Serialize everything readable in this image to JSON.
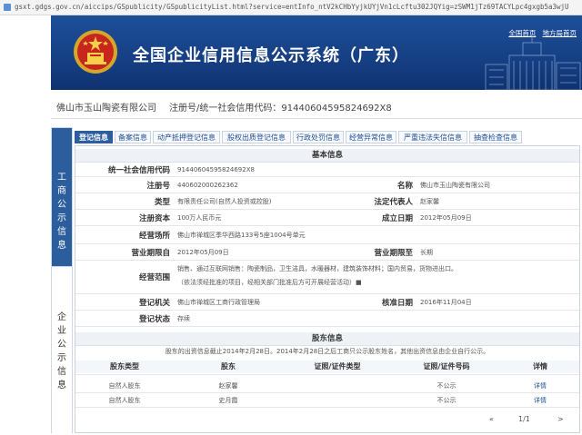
{
  "browser": {
    "url": "gsxt.gdgs.gov.cn/aiccips/GSpublicity/GSpublicityList.html?service=entInfo_ntV2kCHbYyjkUYjVn1cLcftu302JQYig=zSWM1jTz69TACYLpc4gxgb5a3wjU"
  },
  "header": {
    "title": "全国企业信用信息公示系统（广东）",
    "link_home": "全国首页",
    "link_local": "地方局首页"
  },
  "company": {
    "name": "佛山市玉山陶瓷有限公司",
    "reg_label": "注册号/统一社会信用代码：",
    "reg_code": "91440604595824692X8"
  },
  "sidebar": {
    "section_a": [
      "工",
      "商",
      "公",
      "示",
      "信",
      "息"
    ],
    "section_b": [
      "企",
      "业",
      "公",
      "示",
      "信",
      "息"
    ]
  },
  "tabs": [
    {
      "label": "登记信息",
      "active": true
    },
    {
      "label": "备案信息",
      "active": false
    },
    {
      "label": "动产抵押登记信息",
      "active": false
    },
    {
      "label": "股权出质登记信息",
      "active": false
    },
    {
      "label": "行政处罚信息",
      "active": false
    },
    {
      "label": "经营异常信息",
      "active": false
    },
    {
      "label": "严重违法失信信息",
      "active": false
    },
    {
      "label": "抽查检查信息",
      "active": false
    }
  ],
  "basic": {
    "heading": "基本信息",
    "credit_code_label": "统一社会信用代码",
    "credit_code": "91440604595824692X8",
    "reg_no_label": "注册号",
    "reg_no": "440602000262362",
    "name_label": "名称",
    "name": "佛山市玉山陶瓷有限公司",
    "type_label": "类型",
    "type": "有限责任公司(自然人投资或控股)",
    "legal_rep_label": "法定代表人",
    "legal_rep": "赵家馨",
    "capital_label": "注册资本",
    "capital": "100万人民币元",
    "established_label": "成立日期",
    "established": "2012年05月09日",
    "address_label": "经营场所",
    "address": "佛山市禅城区季华西路133号5座1004号单元",
    "term_from_label": "营业期限自",
    "term_from": "2012年05月09日",
    "term_to_label": "营业期限至",
    "term_to": "长期",
    "scope_label": "经营范围",
    "scope_line1": "销售、通过互联网销售：陶瓷制品，卫生洁具，水暖器材，建筑装饰材料；国内贸易，货物进出口。",
    "scope_line2": "（依法须经批准的项目，经相关部门批准后方可开展经营活动）■",
    "authority_label": "登记机关",
    "authority": "佛山市禅城区工商行政管理局",
    "approved_label": "核准日期",
    "approved": "2016年11月04日",
    "status_label": "登记状态",
    "status": "存续"
  },
  "shareholders": {
    "heading": "股东信息",
    "note": "股东的出资信息截止2014年2月28日。2014年2月28日之后工商只公示股东姓名，其他出资信息由企业自行公示。",
    "columns": [
      "股东类型",
      "股东",
      "证照/证件类型",
      "证照/证件号码",
      "详情"
    ],
    "rows": [
      {
        "type": "自然人股东",
        "name": "赵家馨",
        "id_type": "",
        "id_no": "不公示",
        "detail": "详情"
      },
      {
        "type": "自然人股东",
        "name": "史月霞",
        "id_type": "",
        "id_no": "不公示",
        "detail": "详情"
      }
    ],
    "pager_prev": "«",
    "pager_text": "1/1",
    "pager_next": ">"
  },
  "colors": {
    "banner": "#1d4f99",
    "tab_active": "#2c5d9c",
    "link": "#1f4f96"
  }
}
